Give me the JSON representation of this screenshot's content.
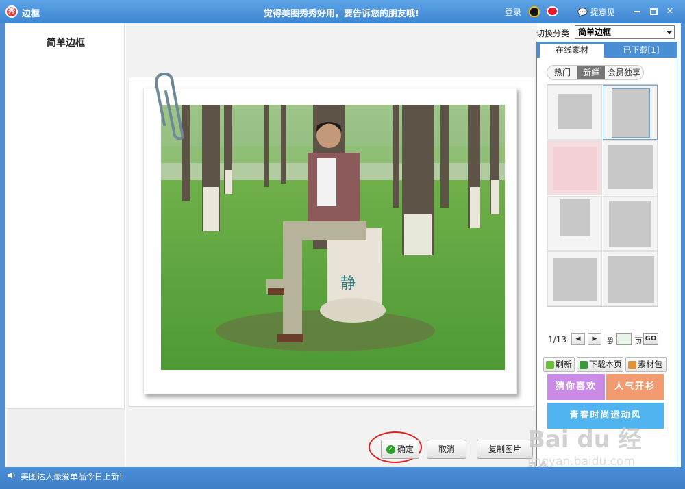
{
  "window": {
    "title": "边框",
    "slogan": "觉得美图秀秀好用，要告诉您的朋友哦!",
    "login": "登录",
    "feedback": "提意见"
  },
  "left_panel": {
    "title": "简单边框"
  },
  "right_panel": {
    "category_label": "切换分类",
    "category_value": "简单边框",
    "tabs": [
      "在线素材",
      "已下载[1]"
    ],
    "subtabs": [
      "热门",
      "新鲜",
      "会员独享"
    ],
    "active_subtab": "新鲜",
    "pager": {
      "current": "1/13",
      "to_label": "到",
      "page_value": "",
      "page_unit": "页",
      "go_label": "GO"
    },
    "actions": {
      "refresh": "刷新",
      "download_page": "下载本页",
      "package": "素材包"
    },
    "banners": {
      "guess": "猜你喜欢",
      "popular": "人气开衫",
      "youth": "青春时尚运动风"
    }
  },
  "photo": {
    "bag_text": "静"
  },
  "buttons": {
    "ok": "确定",
    "cancel": "取消",
    "copy": "复制图片"
  },
  "status": {
    "text": "美图达人最爱单品今日上新!"
  },
  "watermark": {
    "brand": "Bai du 经验",
    "url": "jingyan.baidu.com"
  }
}
